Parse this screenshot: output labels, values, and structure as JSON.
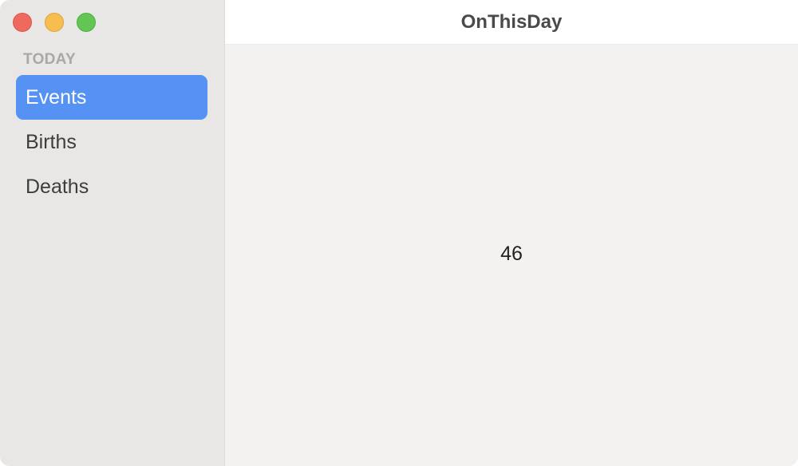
{
  "window": {
    "title": "OnThisDay"
  },
  "sidebar": {
    "section_header": "TODAY",
    "items": [
      {
        "label": "Events",
        "selected": true
      },
      {
        "label": "Births",
        "selected": false
      },
      {
        "label": "Deaths",
        "selected": false
      }
    ]
  },
  "main": {
    "count": "46"
  },
  "colors": {
    "accent": "#5592f4",
    "close": "#ee6a5f",
    "minimize": "#f5be4f",
    "zoom": "#62c554"
  }
}
